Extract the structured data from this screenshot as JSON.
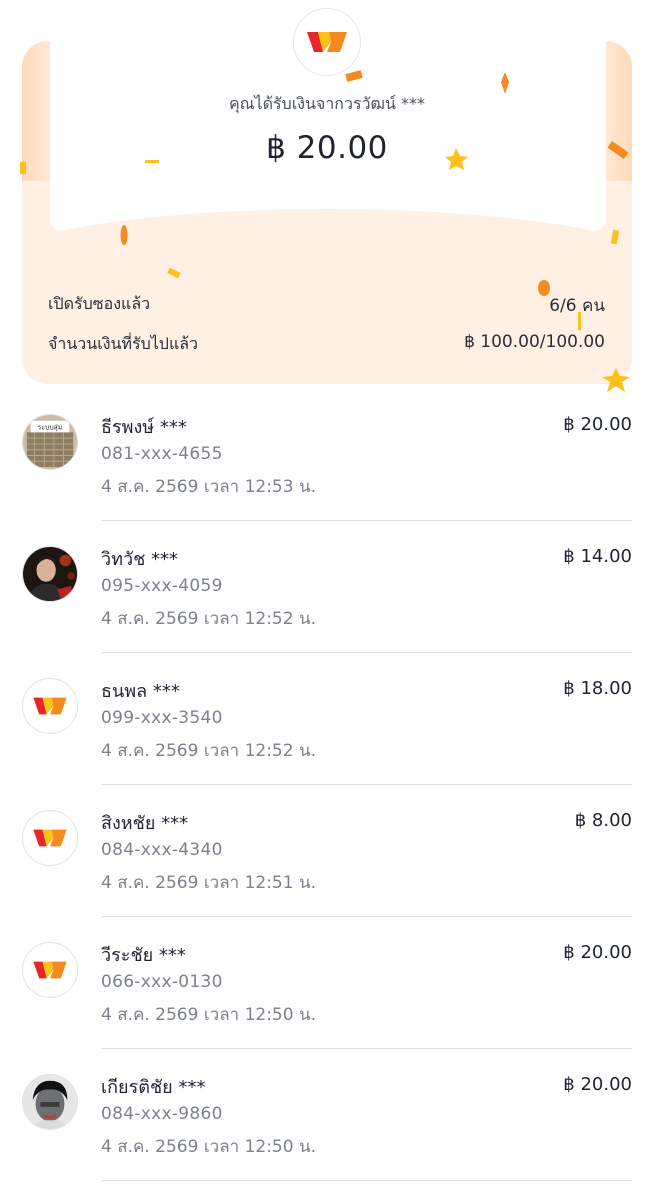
{
  "envelope": {
    "sender_text": "คุณได้รับเงินจากวรวัฒน์ ***",
    "amount": "฿ 20.00",
    "opened_label": "เปิดรับซองแล้ว",
    "opened_value": "6/6 คน",
    "received_label": "จำนวนเงินที่รับไปแล้ว",
    "received_value": "฿ 100.00/100.00"
  },
  "colors": {
    "brand_red": "#e8262a",
    "brand_orange": "#f58a1f",
    "brand_yellow": "#fbc21b",
    "envelope_bg": "#fff0e3"
  },
  "recipients": [
    {
      "name": "ธีรพงษ์ ***",
      "phone": "081-xxx-4655",
      "time": "4 ส.ค. 2569 เวลา 12:53 น.",
      "amount": "฿ 20.00",
      "avatar": "photo-sign",
      "avatar_text": "ระบบสุ่ม"
    },
    {
      "name": "วิทวัช ***",
      "phone": "095-xxx-4059",
      "time": "4 ส.ค. 2569 เวลา 12:52 น.",
      "amount": "฿ 14.00",
      "avatar": "photo-person"
    },
    {
      "name": "ธนพล ***",
      "phone": "099-xxx-3540",
      "time": "4 ส.ค. 2569 เวลา 12:52 น.",
      "amount": "฿ 18.00",
      "avatar": "brand-logo"
    },
    {
      "name": "สิงหชัย ***",
      "phone": "084-xxx-4340",
      "time": "4 ส.ค. 2569 เวลา 12:51 น.",
      "amount": "฿ 8.00",
      "avatar": "brand-logo"
    },
    {
      "name": "วีระชัย ***",
      "phone": "066-xxx-0130",
      "time": "4 ส.ค. 2569 เวลา 12:50 น.",
      "amount": "฿ 20.00",
      "avatar": "brand-logo"
    },
    {
      "name": "เกียรติชัย ***",
      "phone": "084-xxx-9860",
      "time": "4 ส.ค. 2569 เวลา 12:50 น.",
      "amount": "฿ 20.00",
      "avatar": "photo-face"
    }
  ]
}
